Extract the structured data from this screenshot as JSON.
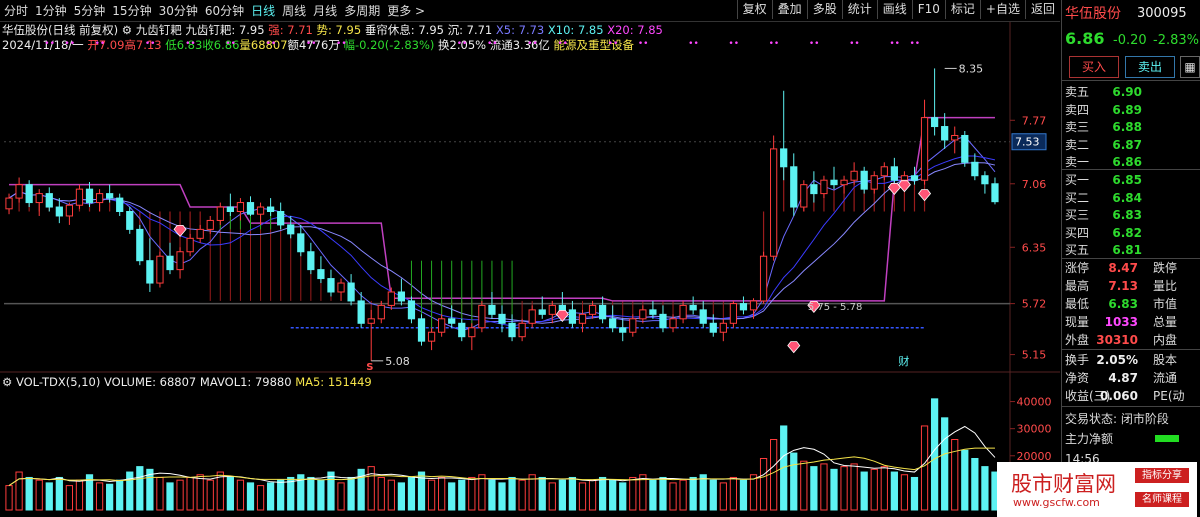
{
  "periods": [
    "分时",
    "1分钟",
    "5分钟",
    "15分钟",
    "30分钟",
    "60分钟",
    "日线",
    "周线",
    "月线",
    "多周期",
    "更多 >"
  ],
  "active_period": "日线",
  "tools": [
    "复权",
    "叠加",
    "多股",
    "统计",
    "画线",
    "F10",
    "标记",
    "+自选",
    "返回"
  ],
  "info1": {
    "title": "华伍股份(日线 前复权)",
    "ind": "九齿钉耙 九齿钉耙: 7.95",
    "q": "强: 7.71",
    "s": "势: 7.95",
    "c": "垂帘休息: 7.95",
    "sink": "沉: 7.71",
    "ma5": "X5: 7.73",
    "ma10": "X10: 7.85",
    "ma20": "X20: 7.85"
  },
  "info2": {
    "date": "2024/11/18/一",
    "open": "开7.09",
    "high": "高7.13",
    "low": "低6.83",
    "close": "收6.86",
    "vol": "量68807",
    "amt": "额4776万",
    "chg": "幅-0.20(-2.83%)",
    "turn": "换2.05%",
    "float": "流通3.36亿",
    "sector": "能源及重型设备"
  },
  "price_axis": [
    "7.77",
    "7.06",
    "6.35",
    "5.72",
    "5.15"
  ],
  "price_marker": "7.53",
  "annotations": {
    "hi": "8.35",
    "lo": "5.08",
    "range": "5.75 - 5.78",
    "cai": "财",
    "s": "S"
  },
  "volinfo": {
    "name": "VOL-TDX(5,10)",
    "vol": "VOLUME: 68807",
    "mavol": "MAVOL1: 79880",
    "ma5": "MA5: 151449"
  },
  "vol_axis": [
    "40000",
    "30000",
    "20000",
    "10000"
  ],
  "quote": {
    "name": "华伍股份",
    "code": "300095",
    "price": "6.86",
    "chg": "-0.20",
    "pct": "-2.83%",
    "buy": "买入",
    "sell": "卖出",
    "asks": [
      {
        "l": "卖五",
        "p": "6.90"
      },
      {
        "l": "卖四",
        "p": "6.89"
      },
      {
        "l": "卖三",
        "p": "6.88"
      },
      {
        "l": "卖二",
        "p": "6.87"
      },
      {
        "l": "卖一",
        "p": "6.86"
      }
    ],
    "bids": [
      {
        "l": "买一",
        "p": "6.85"
      },
      {
        "l": "买二",
        "p": "6.84"
      },
      {
        "l": "买三",
        "p": "6.83"
      },
      {
        "l": "买四",
        "p": "6.82"
      },
      {
        "l": "买五",
        "p": "6.81"
      }
    ],
    "stats": [
      {
        "l": "涨停",
        "v": "8.47",
        "r": "跌停"
      },
      {
        "l": "最高",
        "v": "7.13",
        "r": "量比"
      },
      {
        "l": "最低",
        "v": "6.83",
        "r": "市值"
      },
      {
        "l": "现量",
        "v": "1033",
        "r": "总量"
      },
      {
        "l": "外盘",
        "v": "30310",
        "r": "内盘"
      }
    ],
    "stats2": [
      {
        "l": "换手",
        "v": "2.05%",
        "r": "股本"
      },
      {
        "l": "净资",
        "v": "4.87",
        "r": "流通"
      },
      {
        "l": "收益(三)",
        "v": "0.060",
        "r": "PE(动"
      }
    ],
    "status": "交易状态: 闭市阶段",
    "netflow": "主力净额",
    "time": "14:56"
  },
  "watermark": {
    "title": "股市财富网",
    "url": "www.gscfw.com",
    "tag1": "指标分享",
    "tag2": "名师课程"
  },
  "chart_data": {
    "type": "candlestick",
    "title": "华伍股份(日线 前复权)",
    "ylim": [
      5.0,
      8.5
    ],
    "ohlc": [
      [
        6.78,
        6.95,
        6.72,
        6.9
      ],
      [
        6.9,
        7.13,
        6.85,
        7.05
      ],
      [
        7.05,
        7.1,
        6.8,
        6.85
      ],
      [
        6.85,
        7.0,
        6.7,
        6.95
      ],
      [
        6.95,
        7.02,
        6.75,
        6.8
      ],
      [
        6.8,
        6.9,
        6.62,
        6.7
      ],
      [
        6.7,
        6.85,
        6.6,
        6.82
      ],
      [
        6.82,
        7.05,
        6.78,
        7.0
      ],
      [
        7.0,
        7.08,
        6.8,
        6.85
      ],
      [
        6.85,
        7.0,
        6.75,
        6.95
      ],
      [
        6.95,
        7.05,
        6.85,
        6.9
      ],
      [
        6.9,
        6.95,
        6.7,
        6.75
      ],
      [
        6.75,
        6.8,
        6.5,
        6.55
      ],
      [
        6.55,
        6.6,
        6.15,
        6.2
      ],
      [
        6.2,
        6.45,
        5.85,
        5.95
      ],
      [
        5.95,
        6.3,
        5.9,
        6.25
      ],
      [
        6.25,
        6.4,
        6.05,
        6.1
      ],
      [
        6.1,
        6.35,
        6.0,
        6.3
      ],
      [
        6.3,
        6.5,
        6.25,
        6.45
      ],
      [
        6.45,
        6.6,
        6.4,
        6.55
      ],
      [
        6.55,
        6.7,
        6.5,
        6.65
      ],
      [
        6.65,
        6.85,
        6.6,
        6.8
      ],
      [
        6.8,
        6.95,
        6.7,
        6.75
      ],
      [
        6.75,
        6.9,
        6.65,
        6.85
      ],
      [
        6.85,
        6.92,
        6.7,
        6.72
      ],
      [
        6.72,
        6.85,
        6.6,
        6.8
      ],
      [
        6.8,
        6.9,
        6.7,
        6.75
      ],
      [
        6.75,
        6.85,
        6.55,
        6.6
      ],
      [
        6.6,
        6.7,
        6.45,
        6.5
      ],
      [
        6.5,
        6.6,
        6.25,
        6.3
      ],
      [
        6.3,
        6.4,
        6.05,
        6.1
      ],
      [
        6.1,
        6.25,
        5.95,
        6.0
      ],
      [
        6.0,
        6.1,
        5.8,
        5.85
      ],
      [
        5.85,
        6.0,
        5.75,
        5.95
      ],
      [
        5.95,
        6.05,
        5.7,
        5.75
      ],
      [
        5.75,
        5.85,
        5.45,
        5.5
      ],
      [
        5.5,
        5.65,
        5.08,
        5.55
      ],
      [
        5.55,
        5.75,
        5.5,
        5.7
      ],
      [
        5.7,
        5.9,
        5.65,
        5.85
      ],
      [
        5.85,
        6.0,
        5.7,
        5.75
      ],
      [
        5.75,
        5.8,
        5.5,
        5.55
      ],
      [
        5.55,
        5.6,
        5.25,
        5.3
      ],
      [
        5.3,
        5.45,
        5.2,
        5.4
      ],
      [
        5.4,
        5.6,
        5.35,
        5.55
      ],
      [
        5.55,
        5.7,
        5.45,
        5.5
      ],
      [
        5.5,
        5.55,
        5.3,
        5.35
      ],
      [
        5.35,
        5.5,
        5.2,
        5.45
      ],
      [
        5.45,
        5.75,
        5.4,
        5.7
      ],
      [
        5.7,
        5.85,
        5.55,
        5.6
      ],
      [
        5.6,
        5.7,
        5.4,
        5.5
      ],
      [
        5.5,
        5.6,
        5.3,
        5.35
      ],
      [
        5.35,
        5.55,
        5.3,
        5.5
      ],
      [
        5.5,
        5.7,
        5.45,
        5.65
      ],
      [
        5.65,
        5.8,
        5.55,
        5.6
      ],
      [
        5.6,
        5.75,
        5.5,
        5.7
      ],
      [
        5.7,
        5.85,
        5.6,
        5.65
      ],
      [
        5.65,
        5.75,
        5.45,
        5.5
      ],
      [
        5.5,
        5.65,
        5.4,
        5.6
      ],
      [
        5.6,
        5.75,
        5.55,
        5.7
      ],
      [
        5.7,
        5.8,
        5.5,
        5.55
      ],
      [
        5.55,
        5.7,
        5.4,
        5.45
      ],
      [
        5.45,
        5.55,
        5.3,
        5.4
      ],
      [
        5.4,
        5.6,
        5.35,
        5.55
      ],
      [
        5.55,
        5.7,
        5.5,
        5.65
      ],
      [
        5.65,
        5.75,
        5.55,
        5.6
      ],
      [
        5.6,
        5.7,
        5.4,
        5.45
      ],
      [
        5.45,
        5.6,
        5.4,
        5.55
      ],
      [
        5.55,
        5.75,
        5.5,
        5.7
      ],
      [
        5.7,
        5.8,
        5.6,
        5.65
      ],
      [
        5.65,
        5.75,
        5.45,
        5.5
      ],
      [
        5.5,
        5.6,
        5.35,
        5.4
      ],
      [
        5.4,
        5.55,
        5.3,
        5.5
      ],
      [
        5.5,
        5.75,
        5.45,
        5.72
      ],
      [
        5.72,
        5.8,
        5.6,
        5.65
      ],
      [
        5.65,
        5.78,
        5.55,
        5.75
      ],
      [
        5.75,
        6.3,
        5.72,
        6.25
      ],
      [
        6.25,
        7.6,
        6.2,
        7.45
      ],
      [
        7.45,
        8.1,
        7.1,
        7.25
      ],
      [
        7.25,
        7.4,
        6.7,
        6.8
      ],
      [
        6.8,
        7.1,
        6.75,
        7.05
      ],
      [
        7.05,
        7.2,
        6.85,
        6.95
      ],
      [
        6.95,
        7.15,
        6.9,
        7.1
      ],
      [
        7.1,
        7.25,
        7.0,
        7.05
      ],
      [
        7.05,
        7.15,
        6.95,
        7.1
      ],
      [
        7.1,
        7.3,
        7.05,
        7.2
      ],
      [
        7.2,
        7.25,
        6.95,
        7.0
      ],
      [
        7.0,
        7.2,
        6.95,
        7.15
      ],
      [
        7.15,
        7.3,
        7.1,
        7.25
      ],
      [
        7.25,
        7.35,
        7.05,
        7.1
      ],
      [
        7.1,
        7.2,
        7.0,
        7.15
      ],
      [
        7.15,
        7.25,
        7.05,
        7.1
      ],
      [
        7.1,
        8.0,
        7.05,
        7.8
      ],
      [
        7.8,
        8.35,
        7.6,
        7.7
      ],
      [
        7.7,
        7.85,
        7.45,
        7.55
      ],
      [
        7.55,
        7.7,
        7.4,
        7.6
      ],
      [
        7.6,
        7.65,
        7.25,
        7.3
      ],
      [
        7.3,
        7.4,
        7.1,
        7.15
      ],
      [
        7.15,
        7.2,
        6.95,
        7.06
      ],
      [
        7.06,
        7.13,
        6.83,
        6.86
      ]
    ],
    "volume": [
      9000,
      14000,
      12000,
      11000,
      10000,
      12000,
      9000,
      11000,
      13000,
      10000,
      9500,
      11000,
      14000,
      16000,
      15000,
      12000,
      10000,
      11000,
      12000,
      13000,
      11000,
      14000,
      12000,
      11000,
      10000,
      9000,
      10000,
      11000,
      12000,
      13000,
      12000,
      11000,
      14000,
      10000,
      12000,
      15000,
      16000,
      12000,
      11000,
      10000,
      12000,
      14000,
      11000,
      12000,
      10000,
      11000,
      12000,
      13000,
      11000,
      10000,
      12000,
      11000,
      13000,
      12000,
      10000,
      11000,
      12000,
      10000,
      11000,
      12000,
      11000,
      10000,
      12000,
      13000,
      11000,
      12000,
      10000,
      11000,
      12000,
      13000,
      11000,
      10000,
      12000,
      11000,
      13000,
      19000,
      26000,
      31000,
      21000,
      18000,
      16000,
      17000,
      15000,
      16000,
      17000,
      14000,
      15000,
      16000,
      14000,
      13000,
      12000,
      31000,
      41000,
      34000,
      26000,
      22000,
      19000,
      16000,
      14000
    ]
  }
}
